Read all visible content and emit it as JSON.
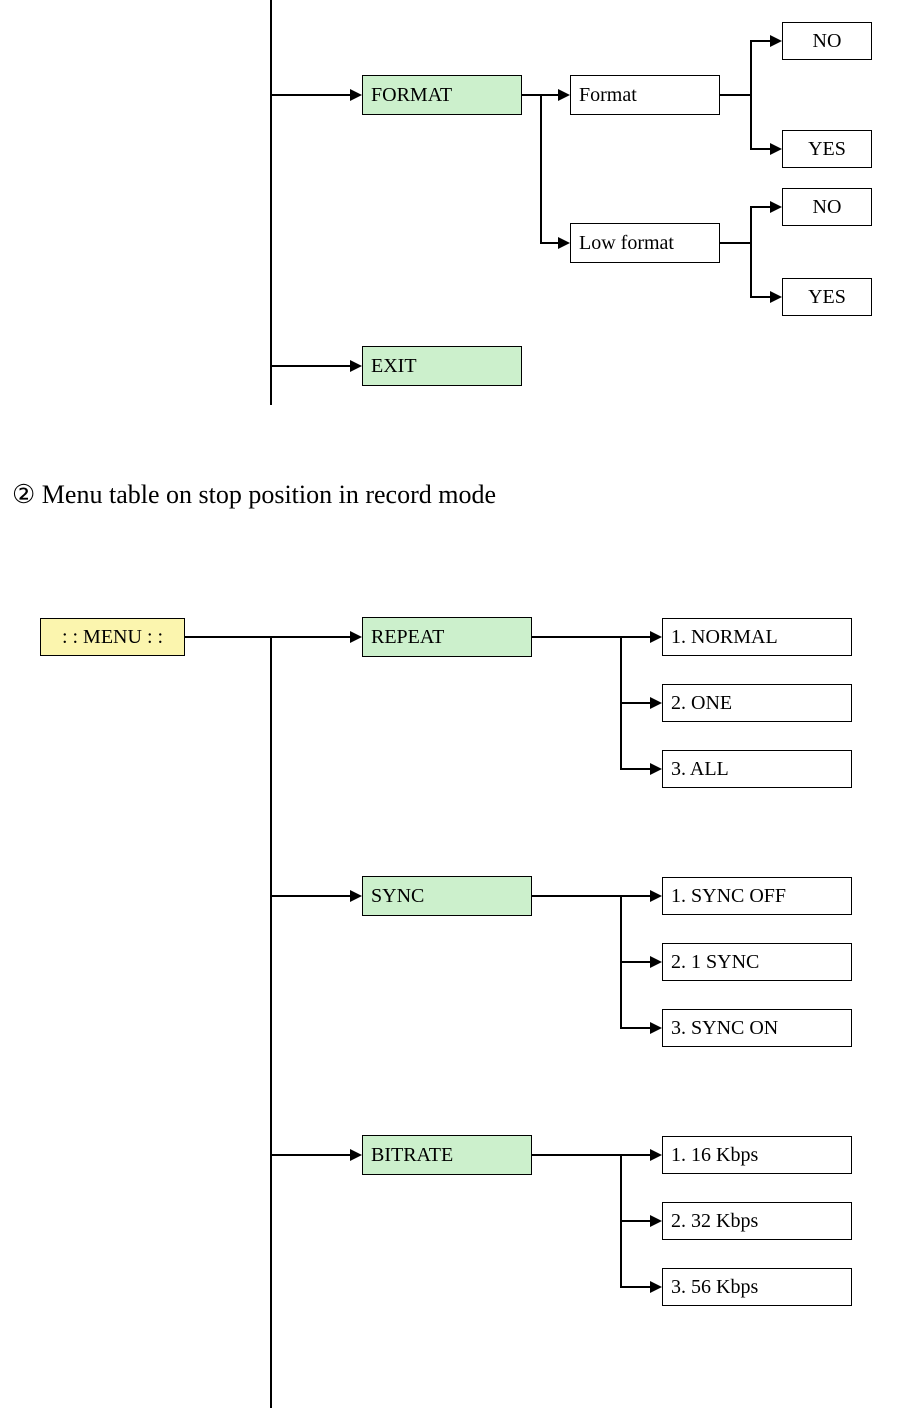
{
  "top": {
    "format": "FORMAT",
    "format_sub": "Format",
    "lowformat": "Low format",
    "no1": "NO",
    "yes1": "YES",
    "no2": "NO",
    "yes2": "YES",
    "exit": "EXIT"
  },
  "heading": "② Menu table on stop position in record mode",
  "menu_label": ": : MENU : :",
  "repeat": {
    "label": "REPEAT",
    "o1": "1. NORMAL",
    "o2": "2. ONE",
    "o3": "3. ALL"
  },
  "sync": {
    "label": "SYNC",
    "o1": "1. SYNC OFF",
    "o2": "2. 1 SYNC",
    "o3": "3. SYNC ON"
  },
  "bitrate": {
    "label": "BITRATE",
    "o1": "1. 16 Kbps",
    "o2": "2. 32 Kbps",
    "o3": "3. 56 Kbps"
  }
}
